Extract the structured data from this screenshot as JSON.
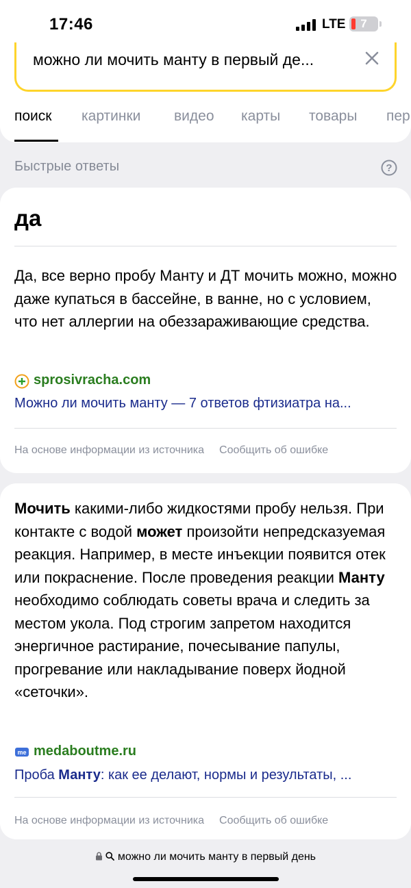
{
  "status_bar": {
    "time": "17:46",
    "network": "LTE",
    "battery_level": "7"
  },
  "search": {
    "query": "можно ли мочить манту в первый де...",
    "clear_icon": "close-icon"
  },
  "tabs": [
    {
      "label": "поиск",
      "active": true
    },
    {
      "label": "картинки",
      "active": false
    },
    {
      "label": "видео",
      "active": false
    },
    {
      "label": "карты",
      "active": false
    },
    {
      "label": "товары",
      "active": false
    },
    {
      "label": "пер",
      "active": false
    }
  ],
  "quick_answers": {
    "title": "Быстрые ответы",
    "help_icon": "question-circle-icon"
  },
  "answer1": {
    "title": "да",
    "body": "Да, все верно пробу Манту и ДТ мочить можно, можно даже купаться в бассейне, в ванне, но с условием, что нет аллергии на обеззараживающие средства.",
    "source_domain": "sprosivracha.com",
    "source_icon": "plus-circle-icon",
    "source_link": "Можно ли мочить манту — 7 ответов фтизиатра на...",
    "footer_based": "На основе информации из источника",
    "footer_report": "Сообщить об ошибке"
  },
  "answer2": {
    "body_parts": [
      {
        "text": "Мочить",
        "bold": true
      },
      {
        "text": " какими-либо жидкостями пробу нельзя. При контакте с водой ",
        "bold": false
      },
      {
        "text": "может",
        "bold": true
      },
      {
        "text": " произойти непредсказуемая реакция. Например, в месте инъекции появится отек или покраснение. После проведения реакции ",
        "bold": false
      },
      {
        "text": "Манту",
        "bold": true
      },
      {
        "text": " необходимо соблюдать советы врача и следить за местом укола. Под строгим запретом находится энергичное растирание, почесывание папулы, прогревание или накладывание поверх йодной «сеточки».",
        "bold": false
      }
    ],
    "source_domain": "medaboutme.ru",
    "source_icon": "me-logo-icon",
    "source_link_parts": [
      {
        "text": "Проба ",
        "bold": false
      },
      {
        "text": "Манту",
        "bold": true
      },
      {
        "text": ": как ее делают, нормы и результаты, ...",
        "bold": false
      }
    ],
    "footer_based": "На основе информации из источника",
    "footer_report": "Сообщить об ошибке"
  },
  "url_bar": {
    "text": "можно ли мочить манту в первый день",
    "lock_icon": "lock-icon",
    "search_icon": "search-icon"
  },
  "colors": {
    "search_border": "#fed42b",
    "source_domain": "#2a7d1f",
    "source_link": "#1a2b8c",
    "muted_text": "#8a8f9c",
    "background": "#efeff2"
  }
}
